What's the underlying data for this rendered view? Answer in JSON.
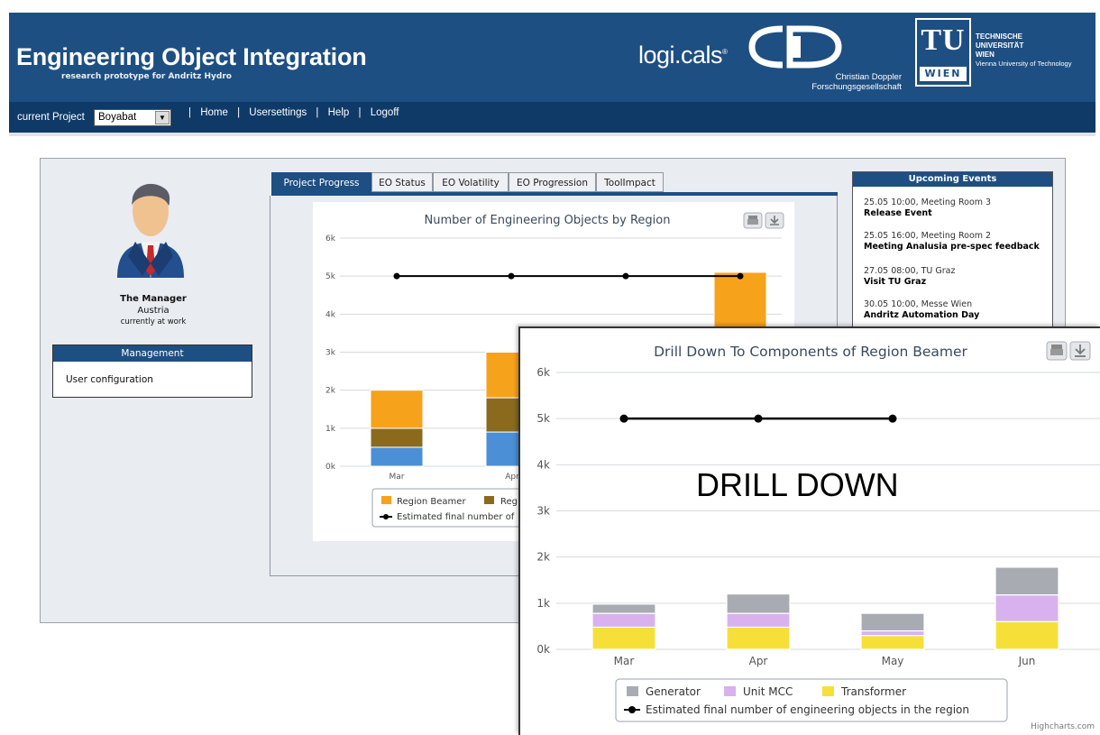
{
  "header": {
    "title": "Engineering Object Integration",
    "subtitle": "research prototype for Andritz Hydro",
    "logicals_logo": "logi.cals",
    "cd_logo_text_1": "Christian Doppler",
    "cd_logo_text_2": "Forschungsgesellschaft",
    "tu_logo_letters": "TU",
    "tu_logo_wien": "WIEN",
    "tu_text_1": "TECHNISCHE",
    "tu_text_2": "UNIVERSITÄT",
    "tu_text_3": "WIEN",
    "tu_text_4": "Vienna University of Technology"
  },
  "nav": {
    "project_label": "current Project",
    "project_value": "Boyabat",
    "links": [
      "Home",
      "Usersettings",
      "Help",
      "Logoff"
    ]
  },
  "profile": {
    "name": "The Manager",
    "country": "Austria",
    "status": "currently at work"
  },
  "management": {
    "header": "Management",
    "link": "User configuration"
  },
  "tabs": [
    "Project Progress",
    "EO Status",
    "EO Volatility",
    "EO Progression",
    "ToolImpact"
  ],
  "events": {
    "header": "Upcoming Events",
    "items": [
      {
        "date": "25.05 10:00, Meeting Room 3",
        "title": "Release Event"
      },
      {
        "date": "25.05 16:00, Meeting Room 2",
        "title": "Meeting Analusia pre-spec feedback"
      },
      {
        "date": "27.05 08:00, TU Graz",
        "title": "Visit TU Graz"
      },
      {
        "date": "30.05 10:00, Messe Wien",
        "title": "Andritz Automation Day"
      }
    ]
  },
  "drill_label": "DRILL DOWN",
  "credit": "Highcharts.com",
  "colors": {
    "header_blue": "#1e4f82",
    "nav_blue": "#0f3a68",
    "orange": "#f7a21b",
    "olive": "#8b6a1e",
    "blue": "#4b8fd6",
    "gray": "#a8acb2",
    "lilac": "#d8b1ee",
    "yellow": "#f7df3a"
  },
  "chart_data": [
    {
      "type": "bar",
      "title": "Number of Engineering Objects by Region",
      "categories": [
        "Mar",
        "Apr"
      ],
      "y_ticks": [
        "0k",
        "1k",
        "2k",
        "3k",
        "4k",
        "5k",
        "6k"
      ],
      "ylim": [
        0,
        6000
      ],
      "stacked": true,
      "series": [
        {
          "name": "Region Beamer",
          "values": [
            1000,
            1200
          ]
        },
        {
          "name": "Reg",
          "values": [
            500,
            900
          ]
        },
        {
          "name": "",
          "values": [
            500,
            900
          ]
        }
      ],
      "extra_bar_value": 5100,
      "line": {
        "name": "Estimated final number of",
        "values": [
          5000,
          5000,
          5000,
          5000
        ]
      },
      "legend_placement": "bottom"
    },
    {
      "type": "bar",
      "title": "Drill Down To Components of Region Beamer",
      "categories": [
        "Mar",
        "Apr",
        "May",
        "Jun"
      ],
      "y_ticks": [
        "0k",
        "1k",
        "2k",
        "3k",
        "4k",
        "5k",
        "6k"
      ],
      "ylim": [
        0,
        6000
      ],
      "stacked": true,
      "series": [
        {
          "name": "Generator",
          "values": [
            200,
            420,
            380,
            600
          ]
        },
        {
          "name": "Unit MCC",
          "values": [
            300,
            300,
            100,
            580
          ]
        },
        {
          "name": "Transformer",
          "values": [
            480,
            480,
            300,
            600
          ]
        }
      ],
      "line": {
        "name": "Estimated final number of engineering objects in the region",
        "values": [
          5000,
          5000,
          5000
        ]
      },
      "legend_placement": "bottom"
    }
  ]
}
